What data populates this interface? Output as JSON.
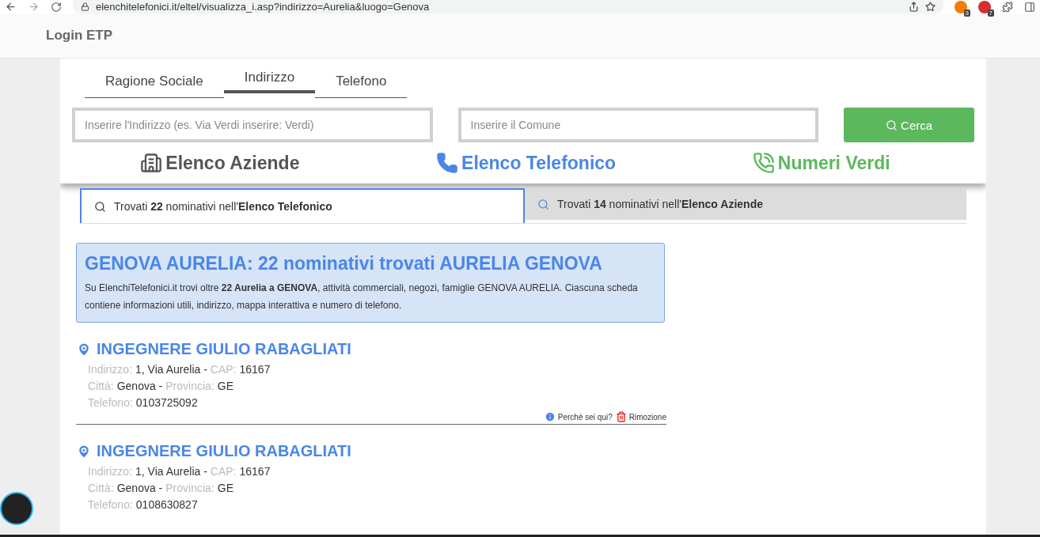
{
  "browser": {
    "url": "elenchitelefonici.it/eltel/visualizza_i.asp?indirizzo=Aurelia&luogo=Genova",
    "badges": [
      "3",
      "7"
    ]
  },
  "header": {
    "login": "Login ETP"
  },
  "search_tabs": [
    {
      "label": "Ragione Sociale",
      "selected": false
    },
    {
      "label": "Indirizzo",
      "selected": true
    },
    {
      "label": "Telefono",
      "selected": false
    }
  ],
  "address_field": {
    "placeholder": "Inserire l'Indirizzo (es. Via Verdi inserire: Verdi)"
  },
  "city_field": {
    "placeholder": "Inserire il Comune"
  },
  "search_button": "Cerca",
  "directories": [
    {
      "kind": "companies",
      "label": "Elenco Aziende",
      "color": "#555555"
    },
    {
      "kind": "phone",
      "label": "Elenco Telefonico",
      "color": "#4a86e8"
    },
    {
      "kind": "green",
      "label": "Numeri Verdi",
      "color": "#5cb85c"
    }
  ],
  "result_tabs": [
    {
      "label": "Trovati **22** nominativi nell'**Elenco Telefonico**",
      "selected": true
    },
    {
      "label": "Trovati **14** nominativi nell'**Elenco Aziende**",
      "selected": false
    }
  ],
  "summary": {
    "title": "GENOVA AURELIA: 22 nominativi trovati AURELIA GENOVA",
    "text": "Su ElenchiTelefonici.it trovi oltre **22 Aurelia a GENOVA**, attività commerciali, negozi, famiglie GENOVA AURELIA. Ciascuna scheda contiene informazioni utili, indirizzo, mappa interattiva e numero di telefono."
  },
  "entries": [
    {
      "name": "INGEGNERE GIULIO RABAGLIATI",
      "lines": [
        [
          {
            "kind": "label",
            "text": "Indirizzo:"
          },
          {
            "kind": "value",
            "text": "1, Via Aurelia -"
          },
          {
            "kind": "label",
            "text": "CAP:"
          },
          {
            "kind": "value",
            "text": "16167"
          }
        ],
        [
          {
            "kind": "label",
            "text": "Città:"
          },
          {
            "kind": "value",
            "text": "Genova -"
          },
          {
            "kind": "label",
            "text": "Provincia:"
          },
          {
            "kind": "value",
            "text": "GE"
          }
        ],
        [
          {
            "kind": "label",
            "text": "Telefono:"
          },
          {
            "kind": "value",
            "text": "0103725092"
          }
        ]
      ],
      "actions": [
        {
          "kind": "info",
          "label": "Perchè sei qui?"
        },
        {
          "kind": "remove",
          "label": "Rimozione"
        }
      ]
    },
    {
      "name": "INGEGNERE GIULIO RABAGLIATI",
      "lines": [
        [
          {
            "kind": "label",
            "text": "Indirizzo:"
          },
          {
            "kind": "value",
            "text": "1, Via Aurelia -"
          },
          {
            "kind": "label",
            "text": "CAP:"
          },
          {
            "kind": "value",
            "text": "16167"
          }
        ],
        [
          {
            "kind": "label",
            "text": "Città:"
          },
          {
            "kind": "value",
            "text": "Genova -"
          },
          {
            "kind": "label",
            "text": "Provincia:"
          },
          {
            "kind": "value",
            "text": "GE"
          }
        ],
        [
          {
            "kind": "label",
            "text": "Telefono:"
          },
          {
            "kind": "value",
            "text": "0108630827"
          }
        ]
      ]
    }
  ]
}
